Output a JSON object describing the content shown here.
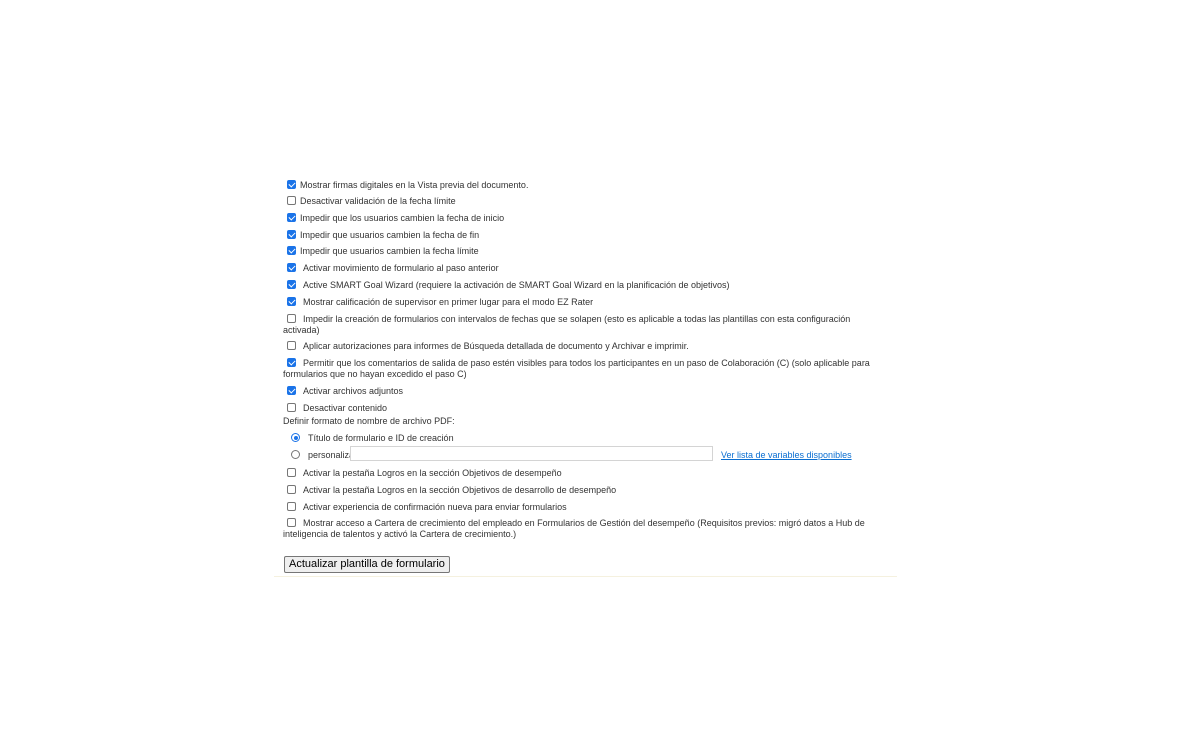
{
  "checkboxes": [
    {
      "label": "Mostrar firmas digitales en la Vista previa del documento.",
      "checked": true
    },
    {
      "label": "Desactivar validación de la fecha límite",
      "checked": false
    },
    {
      "label": "Impedir que los usuarios cambien la fecha de inicio",
      "checked": true
    },
    {
      "label": "Impedir que usuarios cambien la fecha de fin",
      "checked": true
    },
    {
      "label": "Impedir que usuarios cambien la fecha límite",
      "checked": true
    },
    {
      "label": "Activar movimiento de formulario al paso anterior",
      "checked": true
    },
    {
      "label": "Active SMART Goal Wizard (requiere la activación de SMART Goal Wizard en la planificación de objetivos)",
      "checked": true
    },
    {
      "label": "Mostrar calificación de supervisor en primer lugar para el modo EZ Rater",
      "checked": true
    },
    {
      "label": "Impedir la creación de formularios con intervalos de fechas que se solapen (esto es aplicable a todas las plantillas con esta configuración activada)",
      "checked": false
    },
    {
      "label": "Aplicar autorizaciones para informes de Búsqueda detallada de documento y Archivar e imprimir.",
      "checked": false
    },
    {
      "label": "Permitir que los comentarios de salida de paso estén visibles para todos los participantes en un paso de Colaboración (C) (solo aplicable para formularios que no hayan excedido el paso C)",
      "checked": true
    },
    {
      "label": "Activar archivos adjuntos",
      "checked": true
    },
    {
      "label": "Desactivar contenido",
      "checked": false
    }
  ],
  "pdf_format": {
    "heading": "Definir formato de nombre de archivo PDF:",
    "option_title": "Título de formulario e ID de creación",
    "option_custom": "personalizado",
    "custom_value": "",
    "selected": "option_title",
    "variables_link": "Ver lista de variables disponibles"
  },
  "checkboxes_after": [
    {
      "label": "Activar la pestaña Logros en la sección Objetivos de desempeño",
      "checked": false
    },
    {
      "label": "Activar la pestaña Logros en la sección Objetivos de desarrollo de desempeño",
      "checked": false
    },
    {
      "label": "Activar experiencia de confirmación nueva para enviar formularios",
      "checked": false
    },
    {
      "label": "Mostrar acceso a Cartera de crecimiento del empleado en Formularios de Gestión del desempeño (Requisitos previos: migró datos a Hub de inteligencia de talentos y activó la Cartera de crecimiento.)",
      "checked": false
    }
  ],
  "update_button": "Actualizar plantilla de formulario"
}
